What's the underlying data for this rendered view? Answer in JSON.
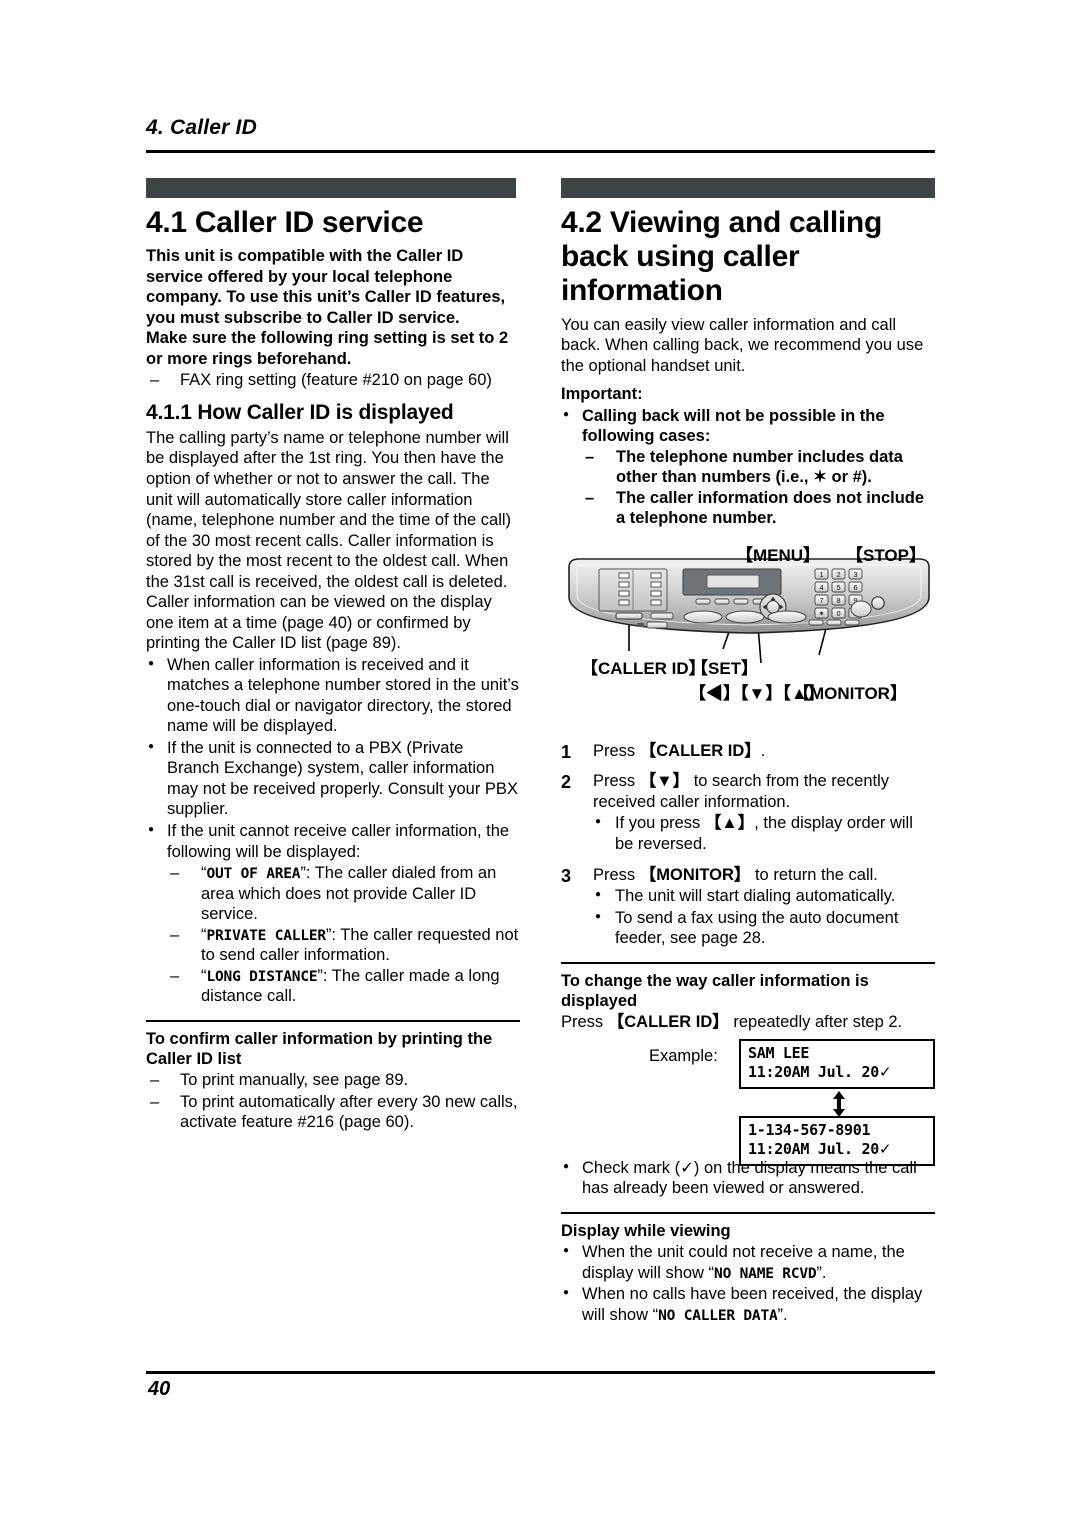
{
  "header": {
    "chapter": "4. Caller ID"
  },
  "footer": {
    "page_number": "40"
  },
  "colors": {
    "section_bar": "#3c4446",
    "text": "#000000",
    "page_background": "#ffffff"
  },
  "left_column": {
    "section": {
      "title": "4.1 Caller ID service",
      "intro_bold_1": "This unit is compatible with the Caller ID service offered by your local telephone company. To use this unit’s Caller ID features, you must subscribe to Caller ID service.",
      "intro_bold_2": "Make sure the following ring setting is set to 2 or more rings beforehand.",
      "ring_setting_item": "FAX ring setting (feature #210 on page 60)"
    },
    "subsection": {
      "title": "4.1.1 How Caller ID is displayed",
      "para_1": "The calling party’s name or telephone number will be displayed after the 1st ring. You then have the option of whether or not to answer the call. The unit will automatically store caller information (name, telephone number and the time of the call) of the 30 most recent calls. Caller information is stored by the most recent to the oldest call. When the 31st call is received, the oldest call is deleted.",
      "para_2": "Caller information can be viewed on the display one item at a time (page 40) or confirmed by printing the Caller ID list (page 89).",
      "bullets": [
        "When caller information is received and it matches a telephone number stored in the unit’s one-touch dial or navigator directory, the stored name will be displayed.",
        "If the unit is connected to a PBX (Private Branch Exchange) system, caller information may not be received properly. Consult your PBX supplier.",
        "If the unit cannot receive caller information, the following will be displayed:"
      ],
      "display_messages": [
        {
          "code": "OUT OF AREA",
          "desc": ": The caller dialed from an area which does not provide Caller ID service."
        },
        {
          "code": "PRIVATE CALLER",
          "desc": ": The caller requested not to send caller information."
        },
        {
          "code": "LONG DISTANCE",
          "desc": ": The caller made a long distance call."
        }
      ]
    },
    "confirm_block": {
      "heading": "To confirm caller information by printing the Caller ID list",
      "items": [
        "To print manually, see page 89.",
        "To print automatically after every 30 new calls, activate feature #216 (page 60)."
      ]
    }
  },
  "right_column": {
    "section": {
      "title": "4.2 Viewing and calling back using caller information",
      "intro": "You can easily view caller information and call back. When calling back, we recommend you use the optional handset unit.",
      "important_label": "Important:",
      "important_bullet": "Calling back will not be possible in the following cases:",
      "important_subitems": [
        "The telephone number includes data other than numbers (i.e., ✶ or #).",
        "The caller information does not include a telephone number."
      ]
    },
    "illustration": {
      "callout_menu": "【MENU】",
      "callout_stop": "【STOP】",
      "callout_caller_id": "【CALLER ID】",
      "callout_set": "【SET】",
      "callout_nav": "【◀】【▼】【▲】",
      "callout_monitor": "【MONITOR】",
      "keypad_rows": [
        [
          "1",
          "2",
          "3"
        ],
        [
          "4",
          "5",
          "6"
        ],
        [
          "7",
          "8",
          "9"
        ],
        [
          "✶",
          "0",
          "#"
        ]
      ]
    },
    "steps": [
      {
        "num": "1",
        "text_before": "Press ",
        "key": "【CALLER ID】",
        "text_after": ".",
        "subitems": []
      },
      {
        "num": "2",
        "text_before": "Press ",
        "key": "【▼】",
        "text_after": " to search from the recently received caller information.",
        "subitems": [
          {
            "before": "If you press ",
            "key": "【▲】",
            "after": ", the display order will be reversed."
          }
        ]
      },
      {
        "num": "3",
        "text_before": "Press ",
        "key": "【MONITOR】",
        "text_after": " to return the call.",
        "subitems": [
          {
            "before": "The unit will start dialing automatically.",
            "key": "",
            "after": ""
          },
          {
            "before": "To send a fax using the auto document feeder, see page 28.",
            "key": "",
            "after": ""
          }
        ]
      }
    ],
    "change_display": {
      "heading": "To change the way caller information is displayed",
      "instruction_before": "Press ",
      "instruction_key": "【CALLER ID】",
      "instruction_after": " repeatedly after step 2.",
      "example_label": "Example:",
      "lcd_top": {
        "line1": "SAM LEE",
        "line2": "11:20AM Jul. 20",
        "check": "✓"
      },
      "lcd_bottom": {
        "line1": "1-134-567-8901",
        "line2": "11:20AM Jul. 20",
        "check": "✓"
      },
      "check_note": "Check mark (✓) on the display means the call has already been viewed or answered."
    },
    "display_while_viewing": {
      "heading": "Display while viewing",
      "items": [
        {
          "before": "When the unit could not receive a name, the display will show “",
          "code": "NO NAME RCVD",
          "after": "”."
        },
        {
          "before": "When no calls have been received, the display will show “",
          "code": "NO CALLER DATA",
          "after": "”."
        }
      ]
    }
  }
}
